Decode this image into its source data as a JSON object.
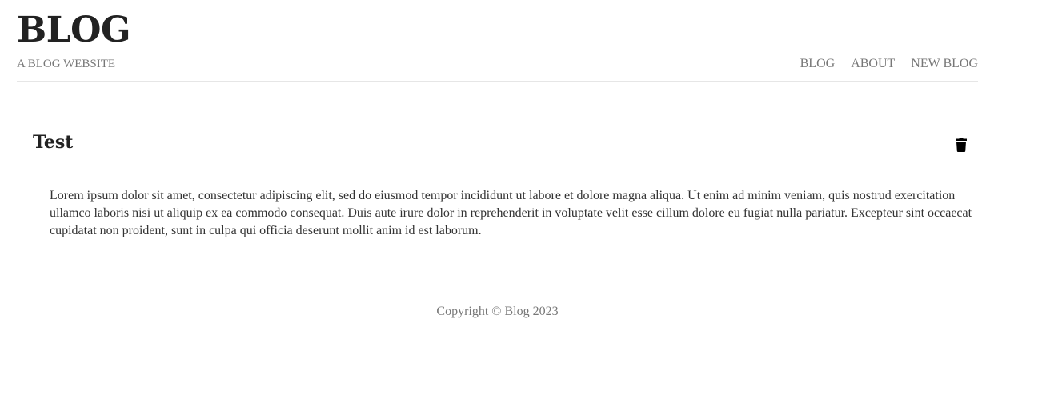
{
  "header": {
    "title": "BLOG",
    "tagline": "A BLOG WEBSITE",
    "nav": [
      {
        "label": "BLOG"
      },
      {
        "label": "ABOUT"
      },
      {
        "label": "NEW BLOG"
      }
    ]
  },
  "post": {
    "title": "Test",
    "delete_icon": "trash-icon",
    "body": "Lorem ipsum dolor sit amet, consectetur adipiscing elit, sed do eiusmod tempor incididunt ut labore et dolore magna aliqua. Ut enim ad minim veniam, quis nostrud exercitation ullamco laboris nisi ut aliquip ex ea commodo consequat. Duis aute irure dolor in reprehenderit in voluptate velit esse cillum dolore eu fugiat nulla pariatur. Excepteur sint occaecat cupidatat non proident, sunt in culpa qui officia deserunt mollit anim id est laborum."
  },
  "footer": {
    "copyright": "Copyright © Blog 2023"
  },
  "colors": {
    "text": "#222222",
    "muted": "#777777",
    "divider": "#e6e6e6"
  }
}
